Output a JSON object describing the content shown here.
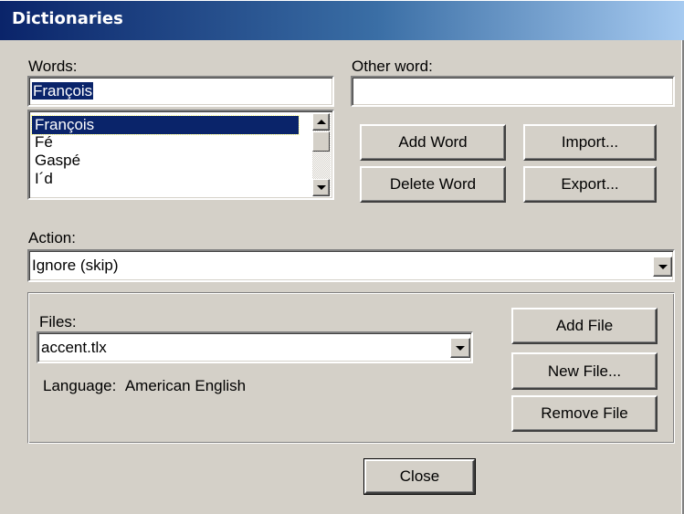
{
  "window": {
    "title": "Dictionaries"
  },
  "words": {
    "label": "Words:",
    "value": "François",
    "list": [
      "François",
      "Fé",
      "Gaspé",
      "I´d"
    ]
  },
  "other_word": {
    "label": "Other word:",
    "value": ""
  },
  "buttons": {
    "add_word": "Add Word",
    "import": "Import...",
    "delete_word": "Delete Word",
    "export": "Export...",
    "add_file": "Add File",
    "new_file": "New File...",
    "remove_file": "Remove File",
    "close": "Close"
  },
  "action": {
    "label": "Action:",
    "value": "Ignore (skip)"
  },
  "files": {
    "label": "Files:",
    "value": "accent.tlx",
    "language_label": "Language:",
    "language_value": "American English"
  },
  "icons": [
    "scroll-up-icon",
    "scroll-down-icon",
    "dropdown-arrow-icon"
  ],
  "colors": {
    "title_bar": "#0a246a",
    "selection": "#0a246a",
    "dialog_bg": "#d4d0c8"
  }
}
